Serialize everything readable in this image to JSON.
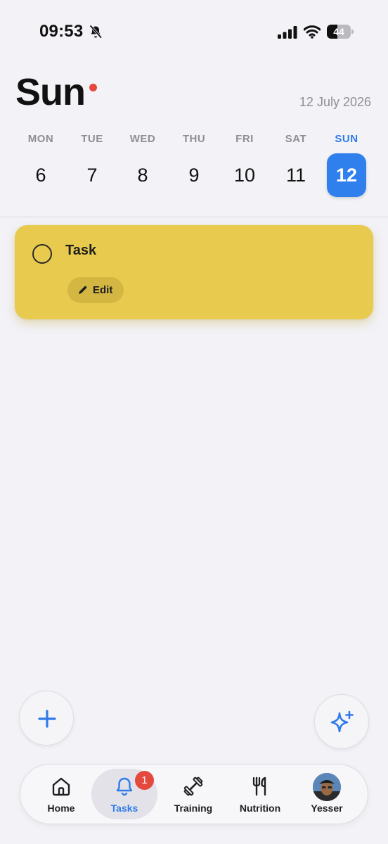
{
  "status_bar": {
    "time": "09:53",
    "battery": "44",
    "battery_level": 0.44
  },
  "header": {
    "day": "Sun",
    "date": "12 July 2026"
  },
  "week": [
    {
      "weekday": "MON",
      "date": "6"
    },
    {
      "weekday": "TUE",
      "date": "7"
    },
    {
      "weekday": "WED",
      "date": "8"
    },
    {
      "weekday": "THU",
      "date": "9"
    },
    {
      "weekday": "FRI",
      "date": "10"
    },
    {
      "weekday": "SAT",
      "date": "11"
    },
    {
      "weekday": "SUN",
      "date": "12",
      "selected": true
    }
  ],
  "tasks": [
    {
      "title": "Task",
      "edit_label": "Edit",
      "color": "#e8cb4e",
      "done": false
    }
  ],
  "tab_bar": {
    "items": [
      {
        "label": "Home",
        "icon": "home-icon"
      },
      {
        "label": "Tasks",
        "icon": "bell-icon",
        "active": true,
        "badge": "1"
      },
      {
        "label": "Training",
        "icon": "dumbbell-icon"
      },
      {
        "label": "Nutrition",
        "icon": "fork-knife-icon"
      },
      {
        "label": "Yesser",
        "icon": "avatar"
      }
    ]
  },
  "colors": {
    "accent": "#2f80ed",
    "background": "#f2f2f7",
    "task": "#e8cb4e",
    "badge": "#e5483d"
  }
}
